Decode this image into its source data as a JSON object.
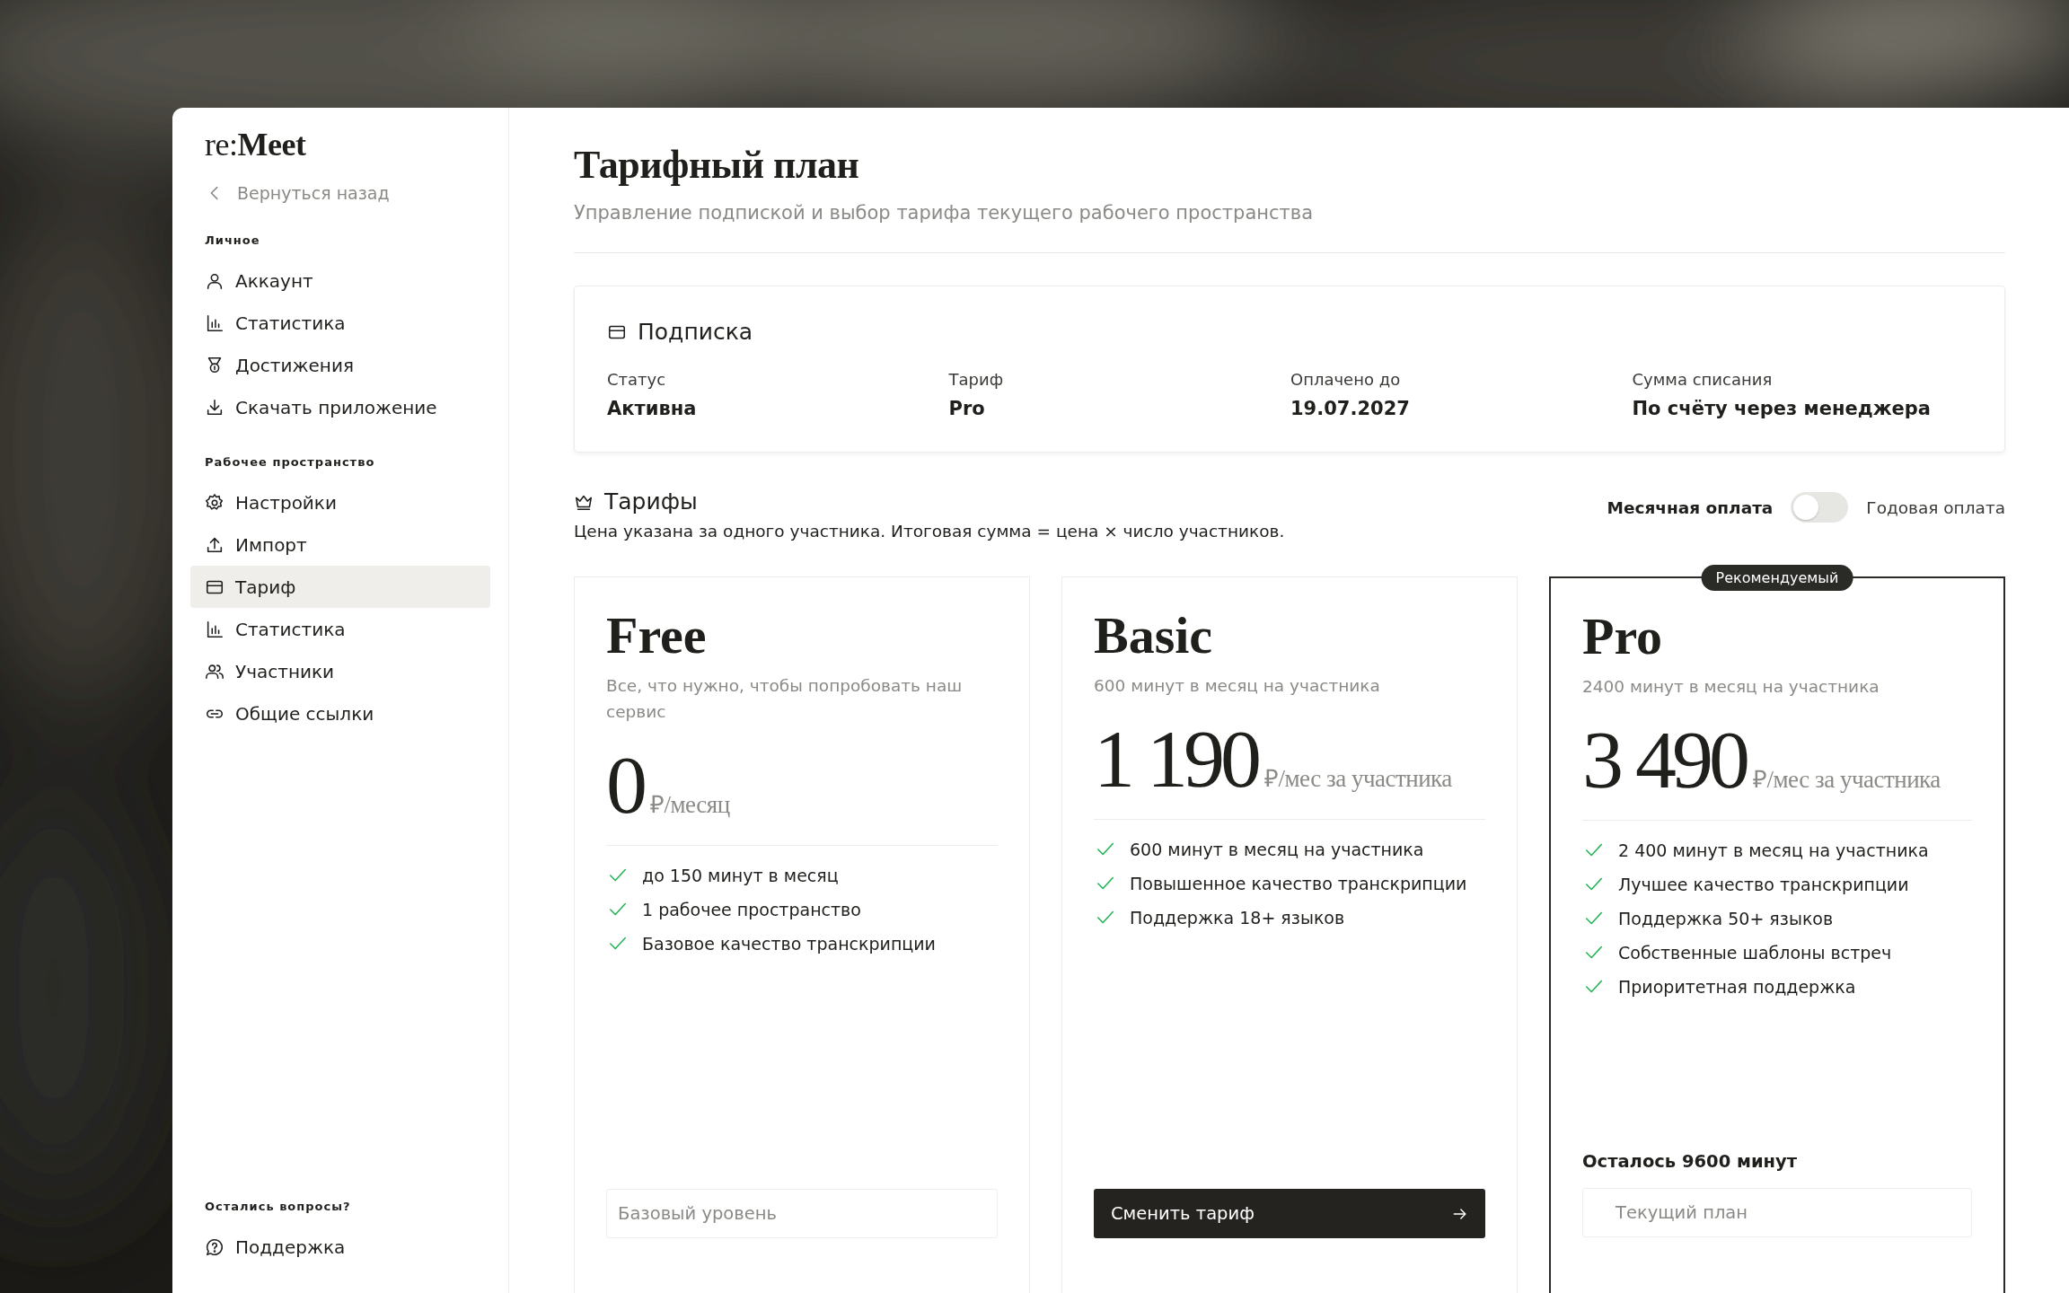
{
  "sidebar": {
    "logo": "re:**Meet**",
    "back_link": "Вернуться назад",
    "sections": [
      {
        "title": "Личное",
        "items": [
          {
            "label": "Аккаунт",
            "kind": "user",
            "selected": false
          },
          {
            "label": "Статистика",
            "kind": "chart",
            "selected": false
          },
          {
            "label": "Достижения",
            "kind": "medal",
            "selected": false
          },
          {
            "label": "Скачать приложение",
            "kind": "download",
            "selected": false
          }
        ]
      },
      {
        "title": "Рабочее пространство",
        "items": [
          {
            "label": "Настройки",
            "kind": "gear",
            "selected": false
          },
          {
            "label": "Импорт",
            "kind": "upload",
            "selected": false
          },
          {
            "label": "Тариф",
            "kind": "card",
            "selected": true
          },
          {
            "label": "Статистика",
            "kind": "chart",
            "selected": false
          },
          {
            "label": "Участники",
            "kind": "users",
            "selected": false
          },
          {
            "label": "Общие ссылки",
            "kind": "link",
            "selected": false
          }
        ]
      }
    ],
    "footer": {
      "title": "Остались вопросы?",
      "items": [
        {
          "label": "Поддержка",
          "kind": "help",
          "selected": false
        }
      ]
    }
  },
  "page": {
    "title": "Тарифный план",
    "subtitle": "Управление подпиской и выбор тарифа текущего рабочего пространства"
  },
  "subscription": {
    "title": "Подписка",
    "fields": [
      {
        "label": "Статус",
        "value": "Активна"
      },
      {
        "label": "Тариф",
        "value": "Pro"
      },
      {
        "label": "Оплачено до",
        "value": "19.07.2027"
      },
      {
        "label": "Сумма списания",
        "value": "По счёту через менеджера"
      }
    ]
  },
  "plans_section": {
    "title": "Тарифы",
    "note": "Цена указана за одного участника. Итоговая сумма = цена × число участников.",
    "billing_toggle": {
      "left_label": "Месячная оплата",
      "right_label": "Годовая оплата",
      "on": false
    }
  },
  "plans": [
    {
      "name": "Free",
      "description": "Все, что нужно, чтобы попробовать наш сервис",
      "price": "0",
      "unit": "₽/месяц",
      "selected": false,
      "features": [
        "до 150 минут в месяц",
        "1 рабочее пространство",
        "Базовое качество транскрипции"
      ],
      "action": {
        "kind": "static",
        "label": "Базовый уровень"
      }
    },
    {
      "name": "Basic",
      "description": "600 минут в месяц на участника",
      "price": "1 190",
      "unit": "₽/мес за участника",
      "selected": false,
      "features": [
        "600 минут в месяц на участника",
        "Повышенное качество транскрипции",
        "Поддержка 18+ языков"
      ],
      "action": {
        "kind": "primary",
        "label": "Сменить тариф"
      }
    },
    {
      "name": "Pro",
      "description": "2400 минут в месяц на участника",
      "price": "3 490",
      "unit": "₽/мес за участника",
      "selected": true,
      "badge": "Рекомендуемый",
      "features": [
        "2 400 минут в месяц на участника",
        "Лучшее качество транскрипции",
        "Поддержка 50+ языков",
        "Собственные шаблоны встреч",
        "Приоритетная поддержка"
      ],
      "remaining": "Осталось 9600 минут",
      "action": {
        "kind": "current",
        "label": "Текущий план"
      }
    }
  ]
}
